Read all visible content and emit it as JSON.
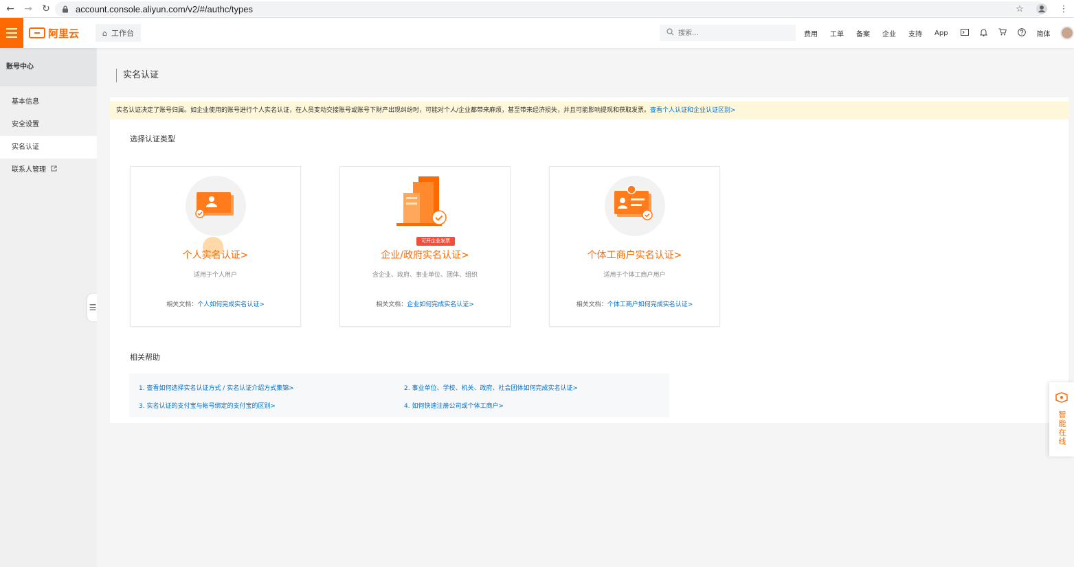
{
  "browser": {
    "url": "account.console.aliyun.com/v2/#/authc/types"
  },
  "topnav": {
    "logo_text": "阿里云",
    "workbench_label": "工作台",
    "search_placeholder": "搜索...",
    "links": [
      "费用",
      "工单",
      "备案",
      "企业",
      "支持",
      "App"
    ],
    "lang_label": "简体"
  },
  "sidebar": {
    "title": "账号中心",
    "items": [
      {
        "label": "基本信息"
      },
      {
        "label": "安全设置"
      },
      {
        "label": "实名认证"
      },
      {
        "label": "联系人管理"
      }
    ]
  },
  "main": {
    "page_title": "实名认证",
    "notice_text": "实名认证决定了账号归属。如企业使用的账号进行个人实名认证，在人员变动交接账号或账号下财产出现纠纷时，可能对个人/企业都带来麻烦，甚至带来经济损失，并且可能影响提现和获取发票。",
    "notice_link": "查看个人认证和企业认证区别>",
    "select_type_label": "选择认证类型",
    "doc_prefix": "相关文档：",
    "cards": [
      {
        "title": "个人实名认证>",
        "desc": "适用于个人用户",
        "doc_link": "个人如何完成实名认证>"
      },
      {
        "title": "企业/政府实名认证>",
        "desc": "含企业、政府、事业单位、团体、组织",
        "doc_link": "企业如何完成实名认证>",
        "badge": "可开企业发票"
      },
      {
        "title": "个体工商户实名认证>",
        "desc": "适用于个体工商户用户",
        "doc_link": "个体工商户如何完成实名认证>"
      }
    ],
    "help_label": "相关帮助",
    "help_links": [
      "1. 查看如何选择实名认证方式 / 实名认证介绍方式集锦>",
      "2. 事业单位、学校、机关、政府、社会团体如何完成实名认证>",
      "3. 实名认证的支付宝与帐号绑定的支付宝的区别>",
      "4. 如何快速注册公司或个体工商户>"
    ]
  },
  "float_help": {
    "label": "智能在线"
  },
  "colors": {
    "brand": "#ff6a00",
    "link": "#0070cc",
    "notice_bg": "#fff7d9"
  }
}
